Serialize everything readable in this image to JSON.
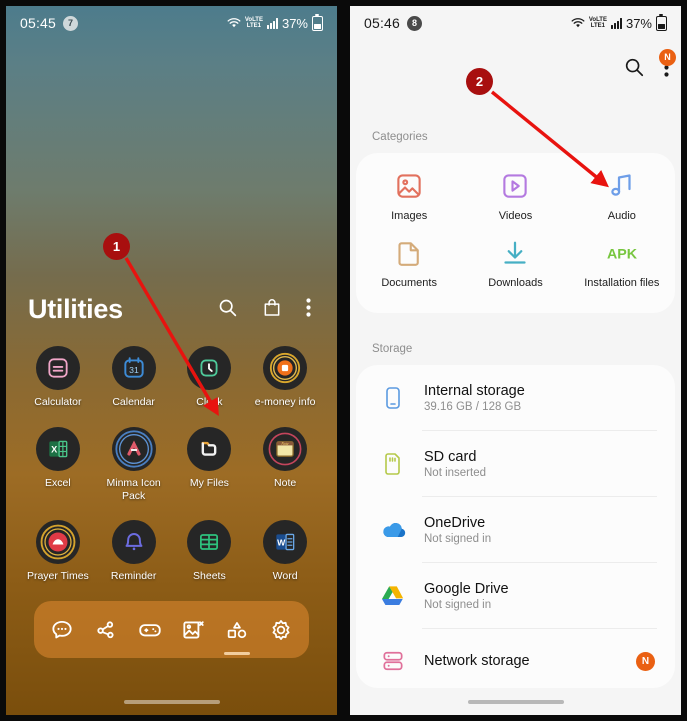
{
  "left_phone": {
    "status_bar": {
      "clock": "05:45",
      "notif_count": "7",
      "network": "LTE1",
      "volte": "VoLTE",
      "battery": "37%"
    },
    "folder": {
      "title": "Utilities",
      "actions": [
        {
          "name": "search-icon",
          "label": "Search"
        },
        {
          "name": "store-icon",
          "label": "Galaxy Store"
        },
        {
          "name": "more-options-icon",
          "label": "More options"
        }
      ],
      "apps": [
        {
          "label": "Calculator",
          "icon": "calculator-icon"
        },
        {
          "label": "Calendar",
          "icon": "calendar-icon"
        },
        {
          "label": "Clock",
          "icon": "clock-icon"
        },
        {
          "label": "e-money info",
          "icon": "emoney-icon"
        },
        {
          "label": "Excel",
          "icon": "excel-icon"
        },
        {
          "label": "Minma Icon Pack",
          "icon": "minma-icon"
        },
        {
          "label": "My Files",
          "icon": "my-files-icon"
        },
        {
          "label": "Note",
          "icon": "note-icon"
        },
        {
          "label": "Prayer Times",
          "icon": "prayer-times-icon"
        },
        {
          "label": "Reminder",
          "icon": "reminder-icon"
        },
        {
          "label": "Sheets",
          "icon": "sheets-icon"
        },
        {
          "label": "Word",
          "icon": "word-icon"
        }
      ]
    },
    "dock": [
      {
        "name": "messages-icon",
        "label": "Messages"
      },
      {
        "name": "share-icon",
        "label": "Quick Share"
      },
      {
        "name": "game-launcher-icon",
        "label": "Game Launcher"
      },
      {
        "name": "gallery-icon",
        "label": "Gallery"
      },
      {
        "name": "apps-icon",
        "label": "Apps"
      },
      {
        "name": "settings-icon",
        "label": "Settings"
      }
    ]
  },
  "right_phone": {
    "status_bar": {
      "clock": "05:46",
      "notif_count": "8",
      "network": "LTE1",
      "volte": "VoLTE",
      "battery": "37%"
    },
    "header": {
      "search": {
        "name": "search-icon",
        "label": "Search"
      },
      "more": {
        "name": "more-options-icon",
        "label": "More options",
        "badge": "N"
      }
    },
    "categories_label": "Categories",
    "categories": [
      {
        "label": "Images",
        "icon": "images-icon",
        "color": "#e2715e"
      },
      {
        "label": "Videos",
        "icon": "videos-icon",
        "color": "#b47ae0"
      },
      {
        "label": "Audio",
        "icon": "audio-icon",
        "color": "#6e9ee8"
      },
      {
        "label": "Documents",
        "icon": "documents-icon",
        "color": "#d4ab7a"
      },
      {
        "label": "Downloads",
        "icon": "downloads-icon",
        "color": "#46afc4"
      },
      {
        "label": "Installation files",
        "icon": "apk-icon",
        "color": "#77c63f"
      }
    ],
    "storage_label": "Storage",
    "storage": [
      {
        "title": "Internal storage",
        "subtitle": "39.16 GB / 128 GB",
        "icon": "phone-icon",
        "badge": ""
      },
      {
        "title": "SD card",
        "subtitle": "Not inserted",
        "icon": "sd-card-icon",
        "badge": ""
      },
      {
        "title": "OneDrive",
        "subtitle": "Not signed in",
        "icon": "onedrive-icon",
        "badge": ""
      },
      {
        "title": "Google Drive",
        "subtitle": "Not signed in",
        "icon": "google-drive-icon",
        "badge": ""
      },
      {
        "title": "Network storage",
        "subtitle": "",
        "icon": "network-storage-icon",
        "badge": "N"
      }
    ]
  },
  "annotations": [
    {
      "number": "1",
      "target": "My Files app icon"
    },
    {
      "number": "2",
      "target": "Audio category"
    }
  ],
  "colors": {
    "marker": "#a80f0f",
    "arrow": "#e8130f",
    "accent_orange": "#ea6012"
  }
}
